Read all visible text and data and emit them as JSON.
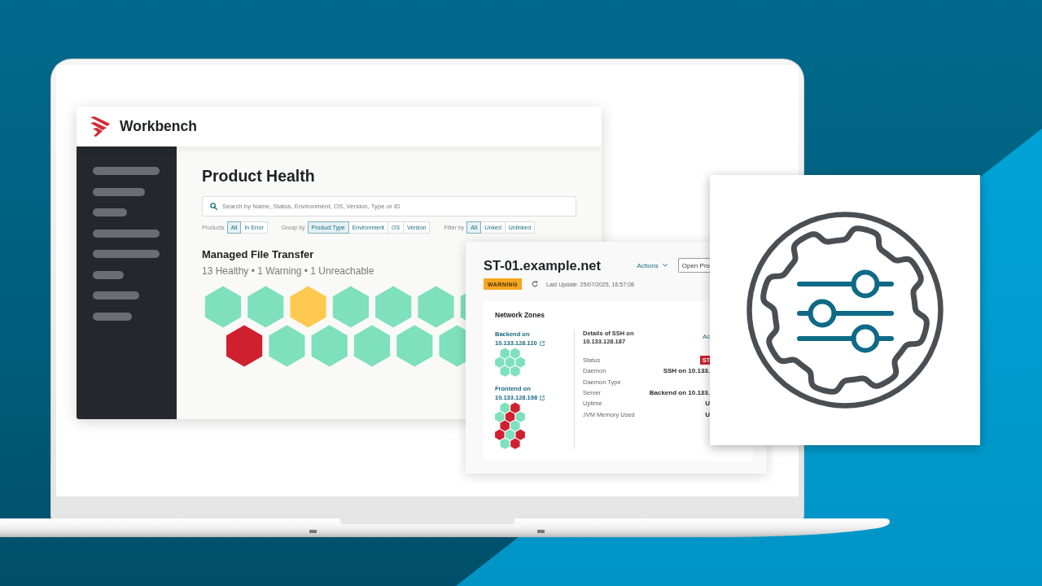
{
  "app": {
    "name": "Workbench",
    "page_title": "Product Health",
    "search": {
      "placeholder": "Search by Name, Status, Environment, OS, Version, Type or ID"
    },
    "filter_groups": [
      {
        "label": "Products",
        "options": [
          {
            "label": "All",
            "selected": true
          },
          {
            "label": "In Error",
            "selected": false
          }
        ]
      },
      {
        "label": "Group by",
        "options": [
          {
            "label": "Product Type",
            "selected": true
          },
          {
            "label": "Environment",
            "selected": false
          },
          {
            "label": "OS",
            "selected": false
          },
          {
            "label": "Version",
            "selected": false
          }
        ]
      },
      {
        "label": "Filter by",
        "options": [
          {
            "label": "All",
            "selected": true
          },
          {
            "label": "Linked",
            "selected": false
          },
          {
            "label": "Unlinked",
            "selected": false
          }
        ]
      }
    ],
    "section": {
      "title": "Managed File Transfer",
      "summary": "13 Healthy • 1 Warning • 1 Unreachable",
      "tile_rows": [
        {
          "tiles": [
            {
              "color": "#7ee0bd"
            },
            {
              "color": "#7ee0bd"
            },
            {
              "color": "#fec94e"
            },
            {
              "color": "#7ee0bd"
            },
            {
              "color": "#7ee0bd"
            },
            {
              "color": "#7ee0bd"
            },
            {
              "color": "#7ee0bd"
            }
          ]
        },
        {
          "tiles": [
            {
              "color": "#d0202e"
            },
            {
              "color": "#7ee0bd"
            },
            {
              "color": "#7ee0bd"
            },
            {
              "color": "#7ee0bd"
            },
            {
              "color": "#7ee0bd"
            },
            {
              "color": "#7ee0bd"
            }
          ]
        }
      ]
    }
  },
  "detail_card": {
    "title": "ST-01.example.net",
    "actions": "Actions",
    "open_button": "Open Pro",
    "status": {
      "label": "WARNING",
      "color": "#f7a621"
    },
    "last_update": "Last Update: 25/07/2025, 16:57:08",
    "network_zones": {
      "title": "Network Zones",
      "zones": [
        {
          "link": "Backend on 10.133.128.110",
          "node_rows": [
            {
              "nodes": [
                {
                  "color": "#7ee0bd"
                },
                {
                  "color": "#7ee0bd"
                }
              ]
            },
            {
              "nodes": [
                {
                  "color": "#7ee0bd"
                },
                {
                  "color": "#7ee0bd"
                },
                {
                  "color": "#7ee0bd"
                }
              ]
            },
            {
              "nodes": [
                {
                  "color": "#7ee0bd"
                },
                {
                  "color": "#7ee0bd"
                }
              ]
            }
          ]
        },
        {
          "link": "Frontend on 10.133.128.198",
          "node_rows": [
            {
              "nodes": [
                {
                  "color": "#7ee0bd"
                },
                {
                  "color": "#d0202e"
                }
              ]
            },
            {
              "nodes": [
                {
                  "color": "#7ee0bd"
                },
                {
                  "color": "#d0202e"
                },
                {
                  "color": "#7ee0bd"
                }
              ]
            },
            {
              "nodes": [
                {
                  "color": "#d0202e"
                },
                {
                  "color": "#7ee0bd"
                }
              ]
            },
            {
              "nodes": [
                {
                  "color": "#d0202e"
                },
                {
                  "color": "#7ee0bd"
                },
                {
                  "color": "#d0202e"
                }
              ]
            },
            {
              "nodes": [
                {
                  "color": "#7ee0bd"
                },
                {
                  "color": "#d0202e"
                }
              ]
            }
          ]
        }
      ]
    },
    "details": {
      "title": "Details of SSH on 10.133.128.187",
      "link": "Ac",
      "rows": [
        {
          "label": "Status",
          "badge": {
            "label": "ST",
            "color": "#d0202e"
          }
        },
        {
          "label": "Daemon",
          "value": "SSH on 10.133."
        },
        {
          "label": "Daemon Type"
        },
        {
          "label": "Server",
          "value": "Backend on 10.133."
        },
        {
          "label": "Uptime",
          "value": "U"
        },
        {
          "label": "JVM Memory Used",
          "value": "U"
        }
      ]
    }
  }
}
